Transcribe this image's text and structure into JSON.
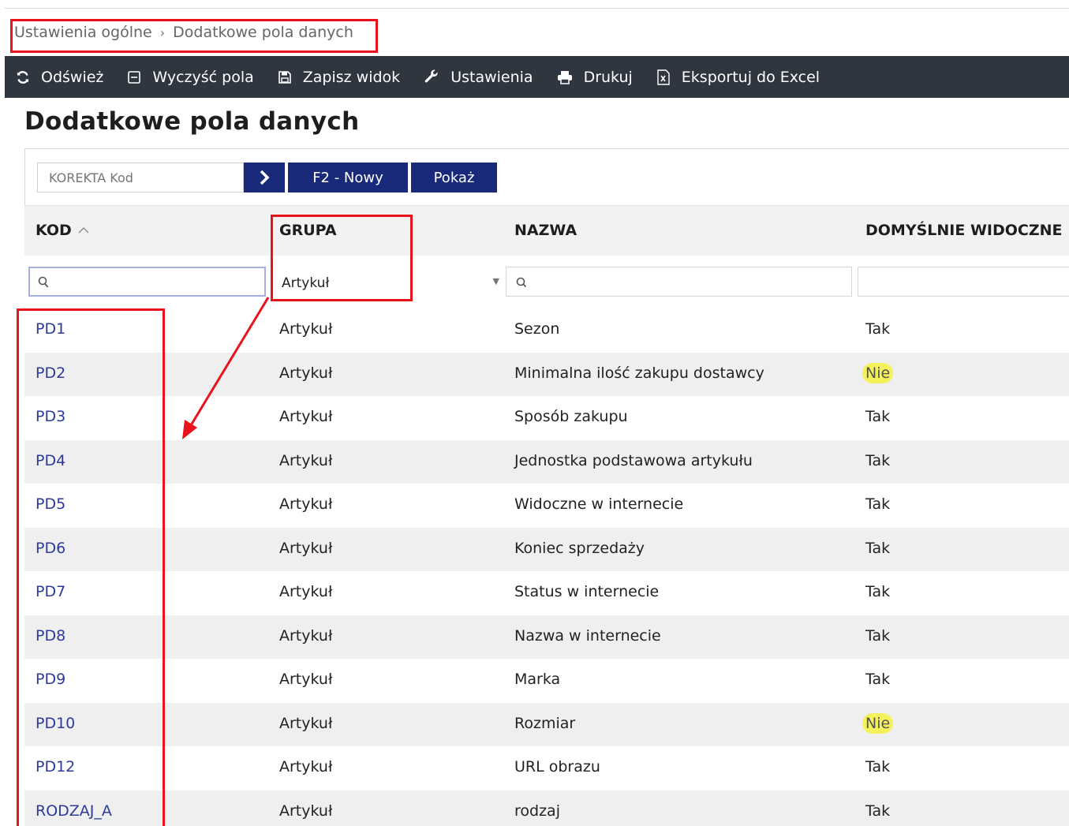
{
  "breadcrumb": {
    "parent": "Ustawienia ogólne",
    "separator": "›",
    "current": "Dodatkowe pola danych"
  },
  "toolbar": {
    "items": [
      {
        "label": "Odśwież",
        "icon": "refresh-icon"
      },
      {
        "label": "Wyczyść pola",
        "icon": "clear-fields-icon"
      },
      {
        "label": "Zapisz widok",
        "icon": "save-icon"
      },
      {
        "label": "Ustawienia",
        "icon": "wrench-icon"
      },
      {
        "label": "Drukuj",
        "icon": "print-icon"
      },
      {
        "label": "Eksportuj do Excel",
        "icon": "excel-icon"
      }
    ]
  },
  "page": {
    "title": "Dodatkowe pola danych"
  },
  "search": {
    "placeholder": "KOREKTA Kod",
    "new_label": "F2 - Nowy",
    "show_label": "Pokaż"
  },
  "table": {
    "headers": {
      "kod": "KOD",
      "grupa": "GRUPA",
      "nazwa": "NAZWA",
      "visible": "DOMYŚLNIE WIDOCZNE"
    },
    "filters": {
      "grupa_selected": "Artykuł"
    },
    "rows": [
      {
        "kod": "PD1",
        "grupa": "Artykuł",
        "nazwa": "Sezon",
        "visible": "Tak",
        "highlight": false
      },
      {
        "kod": "PD2",
        "grupa": "Artykuł",
        "nazwa": "Minimalna ilość zakupu dostawcy",
        "visible": "Nie",
        "highlight": true
      },
      {
        "kod": "PD3",
        "grupa": "Artykuł",
        "nazwa": "Sposób zakupu",
        "visible": "Tak",
        "highlight": false
      },
      {
        "kod": "PD4",
        "grupa": "Artykuł",
        "nazwa": "Jednostka podstawowa artykułu",
        "visible": "Tak",
        "highlight": false
      },
      {
        "kod": "PD5",
        "grupa": "Artykuł",
        "nazwa": "Widoczne w internecie",
        "visible": "Tak",
        "highlight": false
      },
      {
        "kod": "PD6",
        "grupa": "Artykuł",
        "nazwa": "Koniec sprzedaży",
        "visible": "Tak",
        "highlight": false
      },
      {
        "kod": "PD7",
        "grupa": "Artykuł",
        "nazwa": "Status w internecie",
        "visible": "Tak",
        "highlight": false
      },
      {
        "kod": "PD8",
        "grupa": "Artykuł",
        "nazwa": "Nazwa w internecie",
        "visible": "Tak",
        "highlight": false
      },
      {
        "kod": "PD9",
        "grupa": "Artykuł",
        "nazwa": "Marka",
        "visible": "Tak",
        "highlight": false
      },
      {
        "kod": "PD10",
        "grupa": "Artykuł",
        "nazwa": "Rozmiar",
        "visible": "Nie",
        "highlight": true
      },
      {
        "kod": "PD12",
        "grupa": "Artykuł",
        "nazwa": "URL obrazu",
        "visible": "Tak",
        "highlight": false
      },
      {
        "kod": "RODZAJ_A",
        "grupa": "Artykuł",
        "nazwa": "rodzaj",
        "visible": "Tak",
        "highlight": false
      }
    ]
  },
  "colors": {
    "toolbar_bg": "#2f3640",
    "primary_button": "#1a2a7a",
    "link": "#2b3b9c",
    "annotation": "#e8131b",
    "highlight": "#f4f15a"
  }
}
